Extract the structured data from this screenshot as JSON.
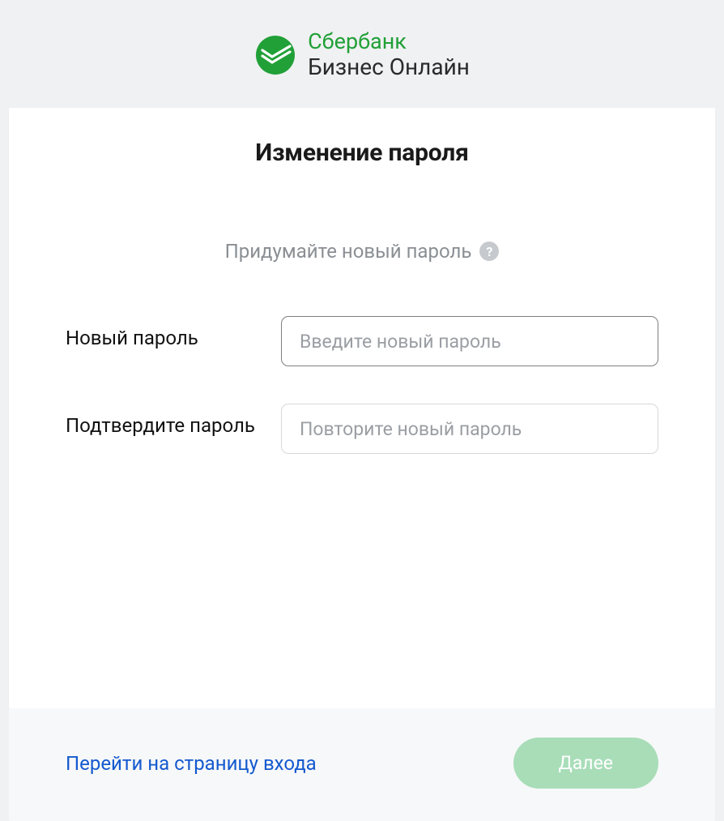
{
  "header": {
    "brand_line1": "Сбербанк",
    "brand_line2": "Бизнес Онлайн"
  },
  "main": {
    "title": "Изменение пароля",
    "subtitle": "Придумайте новый пароль",
    "help_symbol": "?",
    "fields": {
      "new_password": {
        "label": "Новый пароль",
        "placeholder": "Введите новый пароль",
        "value": ""
      },
      "confirm_password": {
        "label": "Подтвердите пароль",
        "placeholder": "Повторите новый пароль",
        "value": ""
      }
    }
  },
  "footer": {
    "login_link": "Перейти на страницу входа",
    "next_label": "Далее"
  },
  "colors": {
    "accent_green": "#21a038",
    "link_blue": "#1459cf",
    "button_green_disabled": "#a8ddb8"
  }
}
